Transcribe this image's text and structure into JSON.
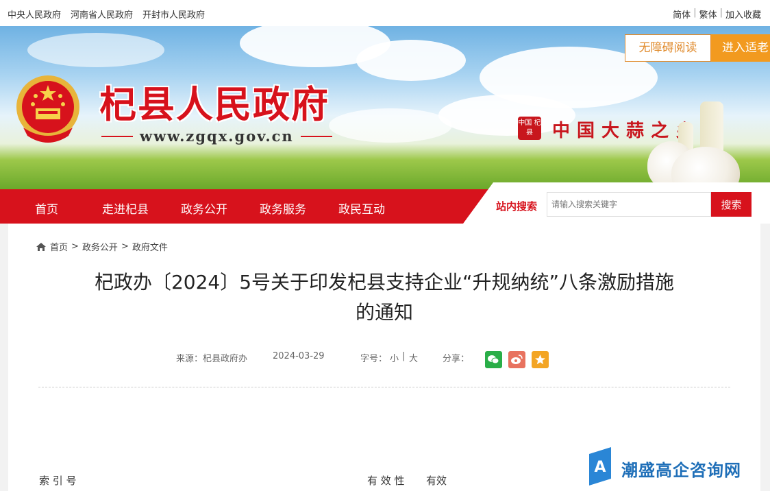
{
  "topbar": {
    "links": [
      "中央人民政府",
      "河南省人民政府",
      "开封市人民政府"
    ],
    "lang": [
      "简体",
      "繁体"
    ],
    "favorite": "加入收藏"
  },
  "header": {
    "site_name": "杞县人民政府",
    "site_url": "www.zgqx.gov.cn",
    "slogan": "中国大蒜之乡",
    "seal_text": "中国 杞县",
    "accessibility_button": "无障碍阅读",
    "elder_button": "进入适老"
  },
  "nav": {
    "items": [
      "首页",
      "走进杞县",
      "政务公开",
      "政务服务",
      "政民互动"
    ],
    "search_label": "站内搜索",
    "search_placeholder": "请输入搜索关键字",
    "search_button": "搜索"
  },
  "breadcrumb": [
    "首页",
    "政务公开",
    "政府文件"
  ],
  "article": {
    "title_line1": "杞政办〔2024〕5号关于印发杞县支持企业“升规纳统”八条激励措施",
    "title_line2": "的通知",
    "source": "来源：杞县政府办",
    "date": "2024-03-29",
    "font_size_label": "字号：",
    "font_small": "小",
    "font_large": "大",
    "share_label": "分享："
  },
  "fields": {
    "index_label": "索 引 号",
    "validity_label": "有 效 性",
    "validity_value": "有效"
  },
  "watermark": {
    "text": "潮盛高企咨询网"
  },
  "colors": {
    "primary_red": "#d7121c",
    "accent_orange": "#f29a1f"
  }
}
